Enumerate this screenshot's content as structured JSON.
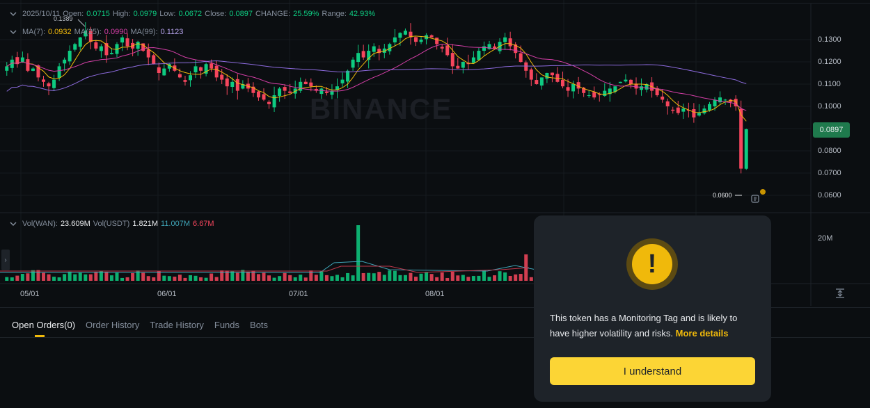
{
  "ohlc": {
    "date": "2025/10/11",
    "open_label": "Open:",
    "open": "0.0715",
    "high_label": "High:",
    "high": "0.0979",
    "low_label": "Low:",
    "low": "0.0672",
    "close_label": "Close:",
    "close": "0.0897",
    "change_label": "CHANGE:",
    "change": "25.59%",
    "range_label": "Range:",
    "range": "42.93%"
  },
  "ma": {
    "ma7_label": "MA(7):",
    "ma7": "0.0932",
    "ma25_label": "MA(25):",
    "ma25": "0.0990",
    "ma99_label": "MA(99):",
    "ma99": "0.1123"
  },
  "volume": {
    "wan_label": "Vol(WAN):",
    "wan": "23.609M",
    "usdt_label": "Vol(USDT)",
    "usdt": "1.821M",
    "v1": "11.007M",
    "v2": "6.67M",
    "axis_label": "20M"
  },
  "price_axis": [
    "0.1300",
    "0.1200",
    "0.1100",
    "0.1000",
    "0.0900",
    "0.0800",
    "0.0700",
    "0.0600"
  ],
  "current_price": "0.0897",
  "high_marker": "0.1389",
  "low_marker": "0.0600",
  "date_axis": [
    "05/01",
    "06/01",
    "07/01",
    "08/01"
  ],
  "watermark": "BINANCE",
  "tabs": [
    {
      "label": "Open Orders(0)"
    },
    {
      "label": "Order History"
    },
    {
      "label": "Trade History"
    },
    {
      "label": "Funds"
    },
    {
      "label": "Bots"
    }
  ],
  "modal": {
    "message": "This token has a Monitoring Tag and is likely to have higher volatility and risks.",
    "link": "More details",
    "button": "I understand",
    "icon": "exclamation-icon"
  },
  "colors": {
    "up": "#0ecb81",
    "down": "#f6465d",
    "accent": "#fcd535",
    "ma7": "#f0b90b",
    "ma25": "#d63fa8",
    "ma99": "#8e6ce0"
  },
  "chart_data": {
    "type": "candlestick",
    "x_range": [
      "05/01",
      "10/11"
    ],
    "ylim": [
      0.06,
      0.14
    ],
    "grid": true,
    "series": [
      {
        "name": "MA(7)",
        "last": 0.0932
      },
      {
        "name": "MA(25)",
        "last": 0.099
      },
      {
        "name": "MA(99)",
        "last": 0.1123
      }
    ],
    "closes": [
      0.118,
      0.121,
      0.119,
      0.122,
      0.116,
      0.117,
      0.113,
      0.111,
      0.109,
      0.112,
      0.118,
      0.121,
      0.125,
      0.128,
      0.131,
      0.134,
      0.129,
      0.126,
      0.127,
      0.123,
      0.124,
      0.128,
      0.131,
      0.127,
      0.126,
      0.129,
      0.125,
      0.122,
      0.119,
      0.115,
      0.117,
      0.119,
      0.116,
      0.113,
      0.111,
      0.114,
      0.118,
      0.116,
      0.119,
      0.117,
      0.113,
      0.112,
      0.109,
      0.111,
      0.107,
      0.11,
      0.108,
      0.106,
      0.104,
      0.103,
      0.101,
      0.105,
      0.108,
      0.107,
      0.106,
      0.108,
      0.111,
      0.11,
      0.109,
      0.107,
      0.108,
      0.106,
      0.107,
      0.109,
      0.112,
      0.116,
      0.121,
      0.124,
      0.122,
      0.125,
      0.127,
      0.124,
      0.126,
      0.128,
      0.131,
      0.133,
      0.134,
      0.131,
      0.129,
      0.13,
      0.132,
      0.131,
      0.128,
      0.126,
      0.123,
      0.118,
      0.117,
      0.12,
      0.119,
      0.122,
      0.125,
      0.127,
      0.128,
      0.126,
      0.129,
      0.131,
      0.127,
      0.124,
      0.12,
      0.116,
      0.112,
      0.11,
      0.113,
      0.115,
      0.114,
      0.111,
      0.109,
      0.107,
      0.11,
      0.108,
      0.106,
      0.105,
      0.104,
      0.105,
      0.107,
      0.108,
      0.109,
      0.111,
      0.112,
      0.11,
      0.108,
      0.109,
      0.11,
      0.107,
      0.105,
      0.103,
      0.1,
      0.098,
      0.097,
      0.099,
      0.098,
      0.095,
      0.097,
      0.099,
      0.101,
      0.103,
      0.104,
      0.103,
      0.102,
      0.1,
      0.072,
      0.0897
    ]
  }
}
